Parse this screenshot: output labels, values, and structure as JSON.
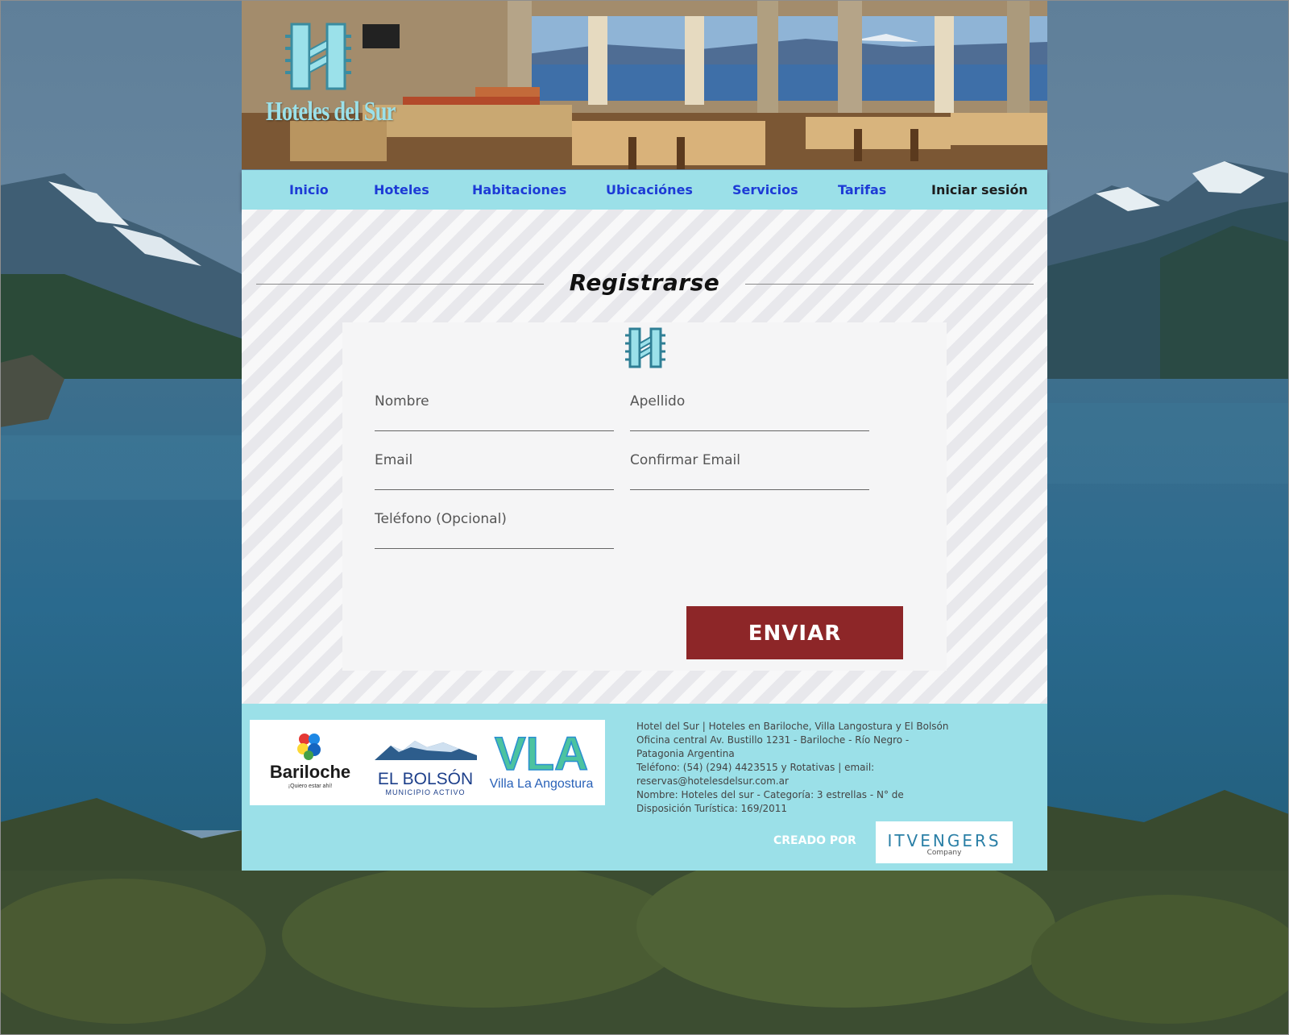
{
  "brand": {
    "name": "Hoteles del Sur"
  },
  "nav": {
    "items": [
      {
        "label": "Inicio"
      },
      {
        "label": "Hoteles"
      },
      {
        "label": "Habitaciones"
      },
      {
        "label": "Ubicaciónes"
      },
      {
        "label": "Servicios"
      },
      {
        "label": "Tarifas"
      },
      {
        "label": "Iniciar sesión"
      }
    ]
  },
  "form": {
    "title": "Registrarse",
    "fields": {
      "nombre": {
        "label": "Nombre",
        "value": ""
      },
      "apellido": {
        "label": "Apellido",
        "value": ""
      },
      "email": {
        "label": "Email",
        "value": ""
      },
      "confirm_email": {
        "label": "Confirmar Email",
        "value": ""
      },
      "telefono": {
        "label": "Teléfono (Opcional)",
        "value": ""
      }
    },
    "submit_label": "ENVIAR"
  },
  "footer": {
    "partners": {
      "bariloche": {
        "name": "Bariloche",
        "tagline": "¡Quiero estar ahí!"
      },
      "el_bolson": {
        "name": "EL BOLSÓN",
        "tagline": "MUNICIPIO ACTIVO"
      },
      "vla": {
        "abbr": "VLA",
        "name": "Villa La Angostura"
      }
    },
    "info": {
      "line1": "Hotel del Sur | Hoteles en Bariloche, Villa Langostura y El Bolsón",
      "line2": "Oficina central Av. Bustillo 1231 - Bariloche - Río Negro - Patagonia Argentina",
      "line3": "Teléfono: (54) (294) 4423515 y Rotativas | email: reservas@hotelesdelsur.com.ar",
      "line4": "Nombre: Hoteles del sur - Categoría: 3 estrellas - N° de Disposición Turística: 169/2011"
    },
    "credit": {
      "label": "CREADO POR",
      "company": "ITVENGERS",
      "company_sub": "Company"
    }
  },
  "colors": {
    "nav_bg": "#9be0e8",
    "nav_link": "#1d3bd6",
    "submit_bg": "#8d2628",
    "logo_accent": "#3a9ab0"
  }
}
